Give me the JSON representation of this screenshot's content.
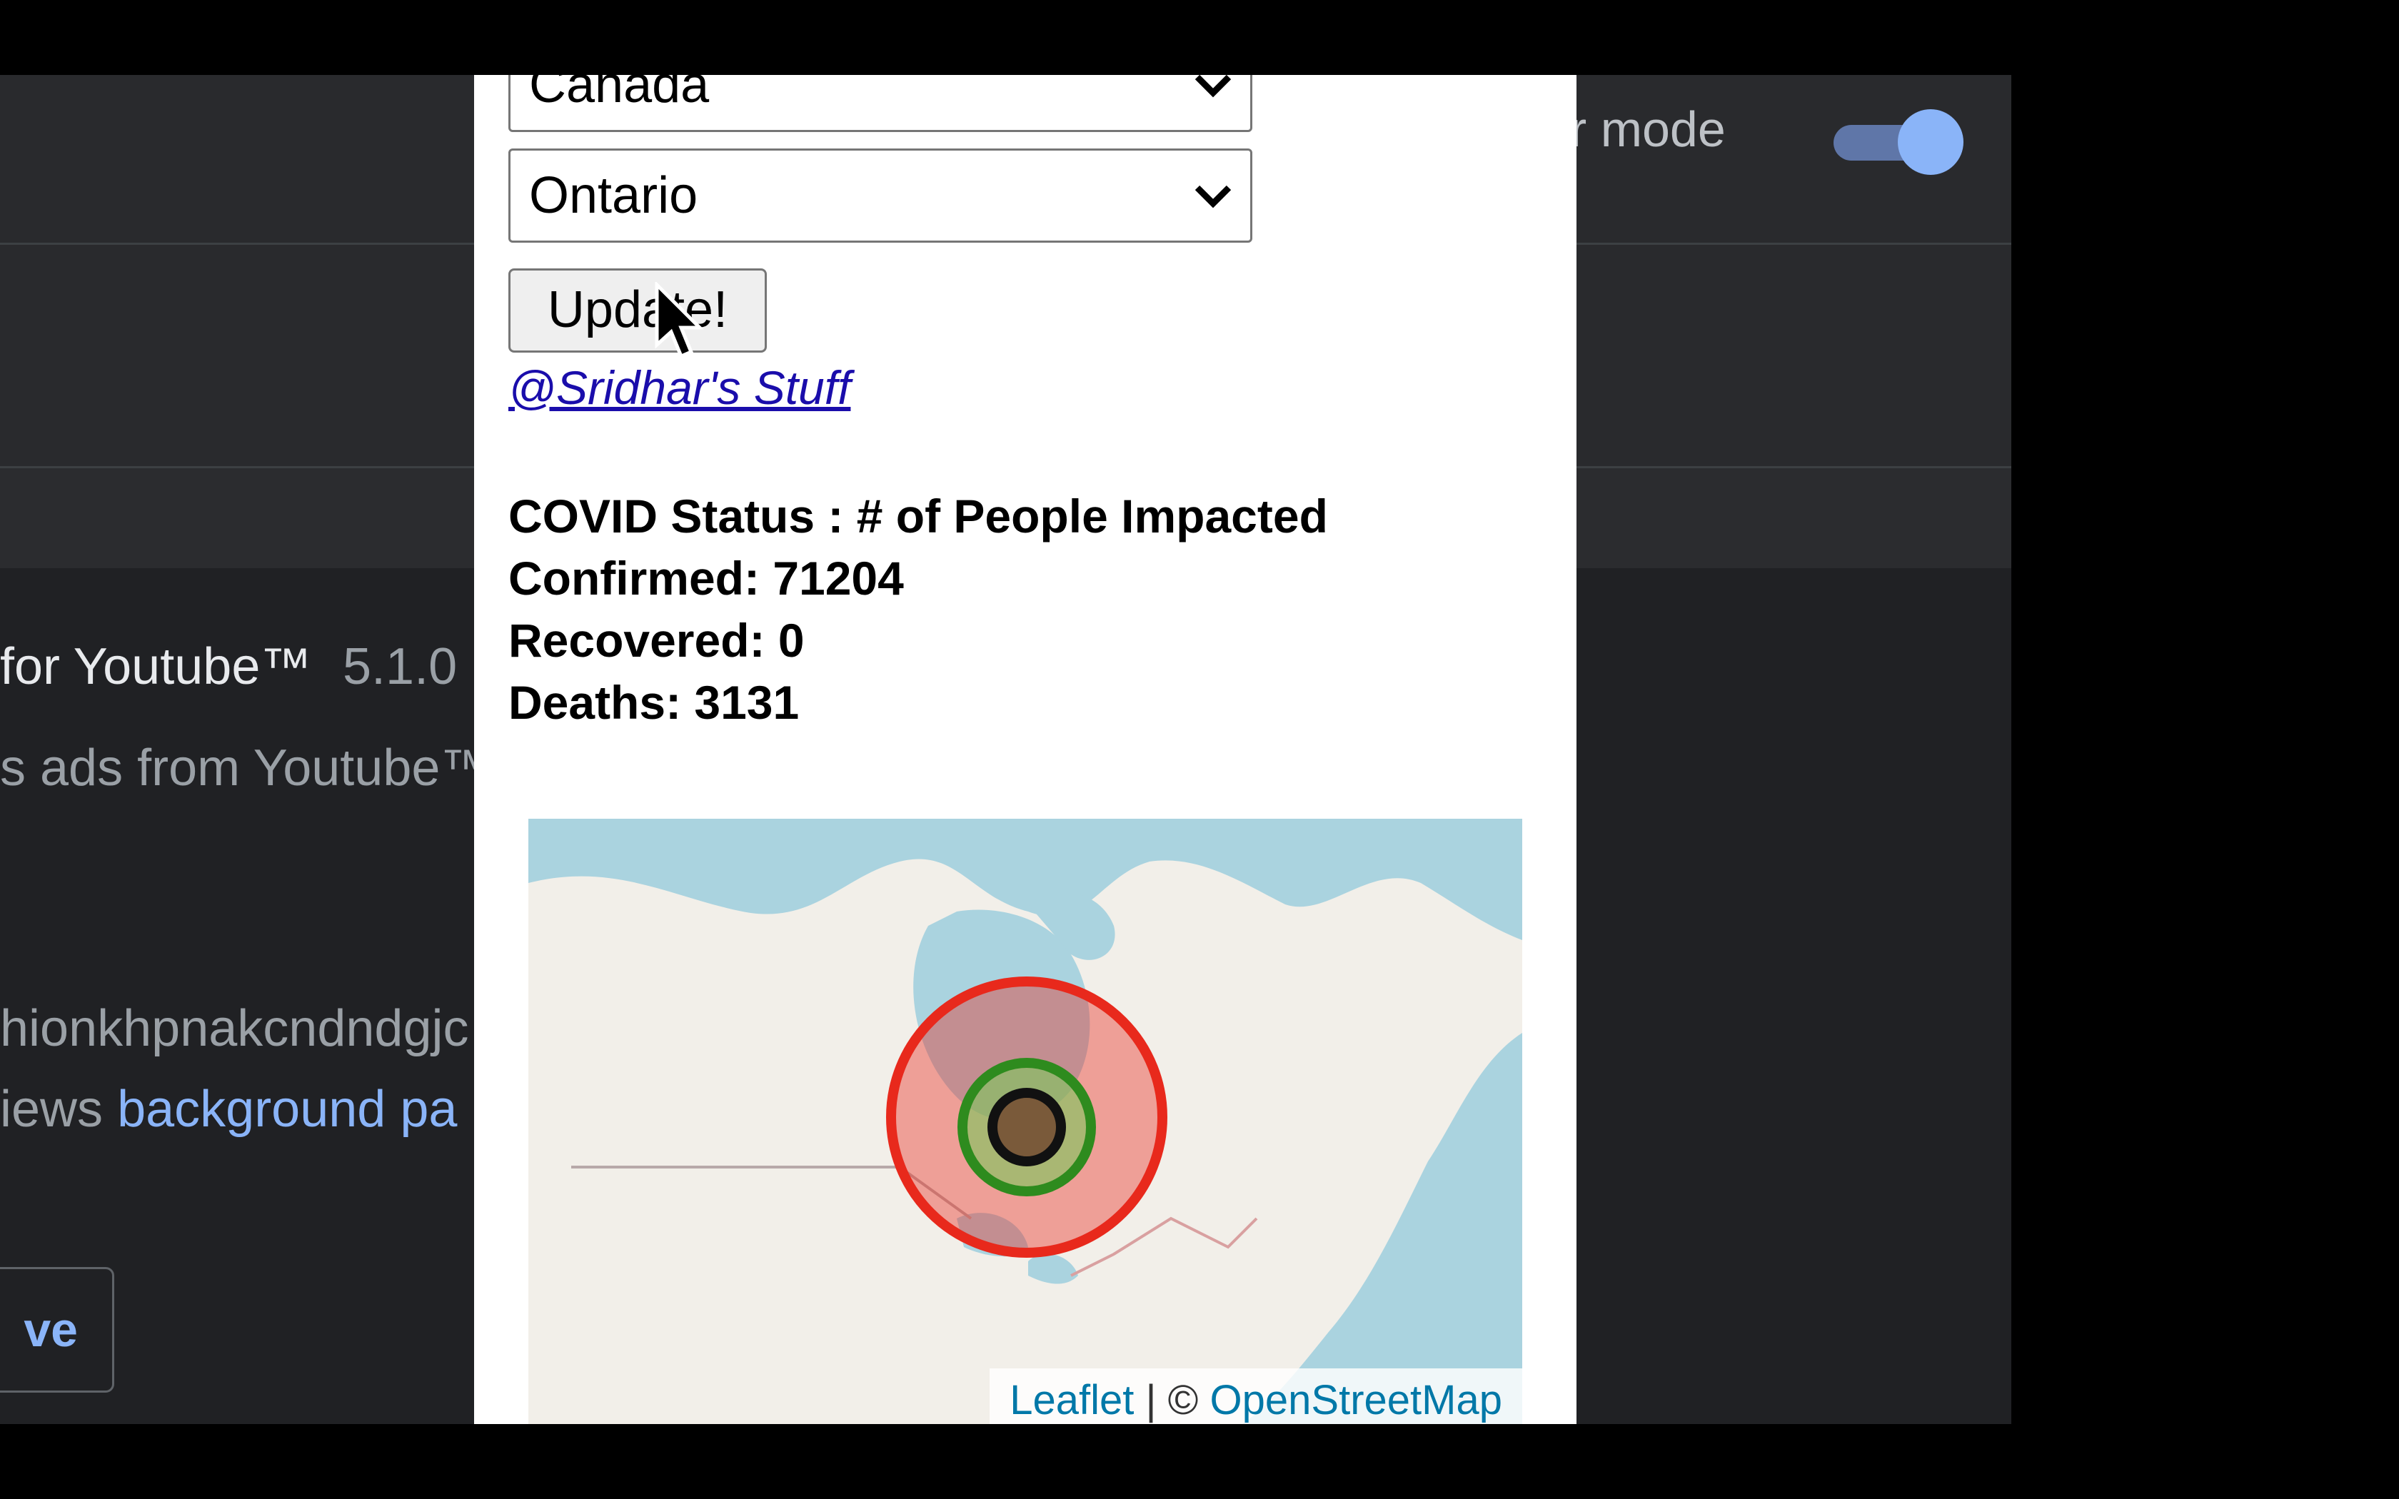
{
  "background_page": {
    "mode_label": "er mode",
    "extension": {
      "name": "for Youtube™",
      "version": "5.1.0",
      "description": "s ads from Youtube™",
      "id_fragment": "hionkhpnakcndndgjc",
      "views_prefix": "iews",
      "views_link": "background pa"
    },
    "remove_button_label": "ve"
  },
  "popup": {
    "country_select": {
      "value": "Canada"
    },
    "region_select": {
      "value": "Ontario"
    },
    "update_button_label": "Update!",
    "site_link": "@Sridhar's Stuff",
    "status": {
      "title": "COVID Status : # of People Impacted",
      "confirmed": "Confirmed: 71204",
      "recovered": "Recovered: 0",
      "deaths": "Deaths: 3131"
    },
    "map": {
      "attribution_leaflet": "Leaflet",
      "attribution_sep": " | © ",
      "attribution_osm": "OpenStreetMap",
      "colors": {
        "water": "#aad3df",
        "land": "#f2efe9",
        "confirmed_circle": "#e8291c",
        "recovered_circle": "#2e8b1e",
        "deaths_circle": "#111111"
      }
    }
  },
  "colors": {
    "bg_page": "#202124",
    "accent_blue": "#8ab4f8",
    "link": "#1a0dab"
  }
}
